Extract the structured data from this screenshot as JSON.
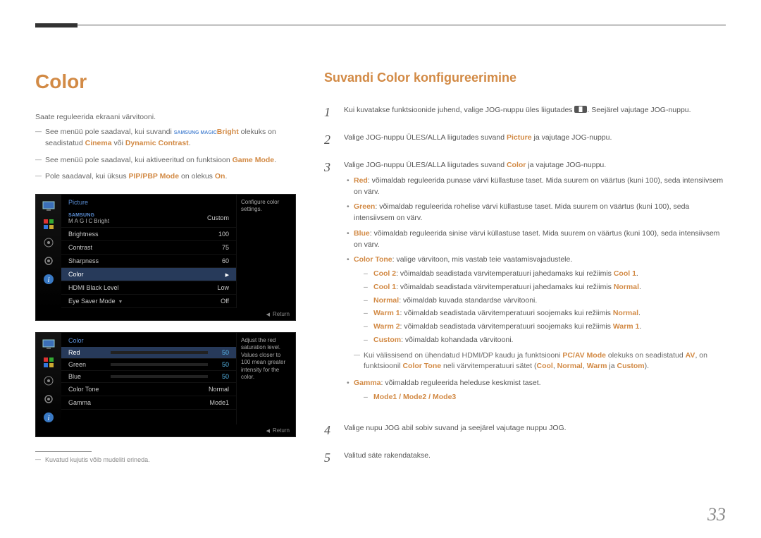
{
  "page_number": "33",
  "heading": "Color",
  "subheading": "Suvandi Color konfigureerimine",
  "intro": "Saate reguleerida ekraani värvitooni.",
  "notes": [
    {
      "prefix": "See menüü pole saadaval, kui suvandi ",
      "magictext": "SAMSUNG MAGIC",
      "bright": "Bright",
      "mid": " olekuks on seadistatud ",
      "o1": "Cinema",
      "sep": " või ",
      "o2": "Dynamic Contrast",
      "suffix": "."
    },
    {
      "text": "See menüü pole saadaval, kui aktiveeritud on funktsioon ",
      "orange": "Game Mode",
      "suffix": "."
    },
    {
      "text": "Pole saadaval, kui üksus ",
      "orange": "PIP/PBP Mode",
      "mid": " on olekus ",
      "orange2": "On",
      "suffix": "."
    }
  ],
  "osd1": {
    "title": "Picture",
    "tip": "Configure color settings.",
    "rows": [
      {
        "label": "",
        "magicbright": true,
        "value": "Custom"
      },
      {
        "label": "Brightness",
        "value": "100"
      },
      {
        "label": "Contrast",
        "value": "75"
      },
      {
        "label": "Sharpness",
        "value": "60"
      },
      {
        "label": "Color",
        "value": "",
        "selected": true,
        "arrow": true
      },
      {
        "label": "HDMI Black Level",
        "value": "Low"
      },
      {
        "label": "Eye Saver Mode",
        "value": "Off",
        "down": true
      }
    ],
    "return": "Return"
  },
  "osd2": {
    "title": "Color",
    "tip": "Adjust the red saturation level. Values closer to 100 mean greater intensity for the color.",
    "bars": [
      {
        "label": "Red",
        "val": "50",
        "cls": "cbar-red",
        "selected": true
      },
      {
        "label": "Green",
        "val": "50",
        "cls": "cbar-green"
      },
      {
        "label": "Blue",
        "val": "50",
        "cls": "cbar-blue"
      }
    ],
    "rows": [
      {
        "label": "Color Tone",
        "value": "Normal"
      },
      {
        "label": "Gamma",
        "value": "Mode1"
      }
    ],
    "return": "Return"
  },
  "footnote": "Kuvatud kujutis võib mudeliti erineda.",
  "steps": {
    "s1": {
      "n": "1",
      "text_a": "Kui kuvatakse funktsioonide juhend, valige JOG-nuppu üles liigutades ",
      "text_b": ". Seejärel vajutage JOG-nuppu."
    },
    "s2": {
      "n": "2",
      "text_a": "Valige JOG-nuppu ÜLES/ALLA liigutades suvand ",
      "orange": "Picture",
      "text_b": " ja vajutage JOG-nuppu."
    },
    "s3": {
      "n": "3",
      "text_a": "Valige JOG-nuppu ÜLES/ALLA liigutades suvand ",
      "orange": "Color",
      "text_b": " ja vajutage JOG-nuppu."
    },
    "s4": {
      "n": "4",
      "text": "Valige nupu JOG abil sobiv suvand ja seejärel vajutage nuppu JOG."
    },
    "s5": {
      "n": "5",
      "text": "Valitud säte rakendatakse."
    }
  },
  "bullets": {
    "red": {
      "lead": "Red",
      "text": ": võimaldab reguleerida punase värvi küllastuse taset. Mida suurem on väärtus (kuni 100), seda intensiivsem on värv."
    },
    "green": {
      "lead": "Green",
      "text": ": võimaldab reguleerida rohelise värvi küllastuse taset. Mida suurem on väärtus (kuni 100), seda intensiivsem on värv."
    },
    "blue": {
      "lead": "Blue",
      "text": ": võimaldab reguleerida sinise värvi küllastuse taset. Mida suurem on väärtus (kuni 100), seda intensiivsem on värv."
    },
    "tone": {
      "lead": "Color Tone",
      "text": ": valige värvitoon, mis vastab teie vaatamisvajadustele."
    },
    "tone_items": [
      {
        "b": "Cool 2",
        "t": ": võimaldab seadistada värvitemperatuuri jahedamaks kui režiimis ",
        "b2": "Cool 1",
        "suffix": "."
      },
      {
        "b": "Cool 1",
        "t": ": võimaldab seadistada värvitemperatuuri jahedamaks kui režiimis ",
        "b2": "Normal",
        "suffix": "."
      },
      {
        "b": "Normal",
        "t": ": võimaldab kuvada standardse värvitooni.",
        "b2": "",
        "suffix": ""
      },
      {
        "b": "Warm 1",
        "t": ": võimaldab seadistada värvitemperatuuri soojemaks kui režiimis ",
        "b2": "Normal",
        "suffix": "."
      },
      {
        "b": "Warm 2",
        "t": ": võimaldab seadistada värvitemperatuuri soojemaks kui režiimis ",
        "b2": "Warm 1",
        "suffix": "."
      },
      {
        "b": "Custom",
        "t": ": võimaldab kohandada värvitooni.",
        "b2": "",
        "suffix": ""
      }
    ],
    "tone_note": {
      "a": "Kui välissisend on ühendatud HDMI/DP kaudu ja funktsiooni ",
      "b": "PC/AV Mode",
      "c": " olekuks on seadistatud ",
      "d": "AV",
      "e": ", on funktsioonil ",
      "f": "Color Tone",
      "g": " neli värvitemperatuuri sätet (",
      "h": "Cool",
      "i": ", ",
      "j": "Normal",
      "k": ", ",
      "l": "Warm",
      "m": " ja ",
      "n": "Custom",
      "o": ")."
    },
    "gamma": {
      "lead": "Gamma",
      "text": ": võimaldab reguleerida heleduse keskmist taset."
    },
    "gamma_modes": "Mode1 / Mode2 / Mode3"
  }
}
